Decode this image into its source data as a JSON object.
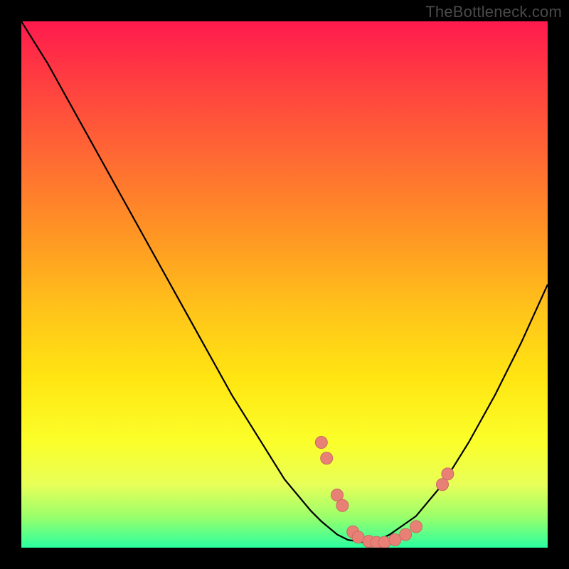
{
  "watermark": "TheBottleneck.com",
  "colors": {
    "background": "#000000",
    "curve": "#000000",
    "marker_fill": "#e98076",
    "marker_stroke": "#c86a62"
  },
  "chart_data": {
    "type": "line",
    "title": "",
    "xlabel": "",
    "ylabel": "",
    "xlim": [
      0,
      100
    ],
    "ylim": [
      0,
      100
    ],
    "x": [
      0,
      5,
      10,
      15,
      20,
      25,
      30,
      35,
      40,
      45,
      50,
      55,
      57,
      60,
      62,
      65,
      68,
      70,
      75,
      80,
      85,
      90,
      95,
      100
    ],
    "y": [
      100,
      92,
      83,
      74,
      65,
      56,
      47,
      38,
      29,
      21,
      13,
      7,
      5,
      2.5,
      1.5,
      1,
      1.5,
      2.5,
      6,
      12,
      20,
      29,
      39,
      50
    ],
    "markers": [
      {
        "x": 57,
        "y": 20
      },
      {
        "x": 58,
        "y": 17
      },
      {
        "x": 60,
        "y": 10
      },
      {
        "x": 61,
        "y": 8
      },
      {
        "x": 63,
        "y": 3
      },
      {
        "x": 64,
        "y": 2
      },
      {
        "x": 66,
        "y": 1.2
      },
      {
        "x": 67.5,
        "y": 1
      },
      {
        "x": 69,
        "y": 1
      },
      {
        "x": 71,
        "y": 1.5
      },
      {
        "x": 73,
        "y": 2.5
      },
      {
        "x": 75,
        "y": 4
      },
      {
        "x": 80,
        "y": 12
      },
      {
        "x": 81,
        "y": 14
      }
    ],
    "annotations": []
  }
}
